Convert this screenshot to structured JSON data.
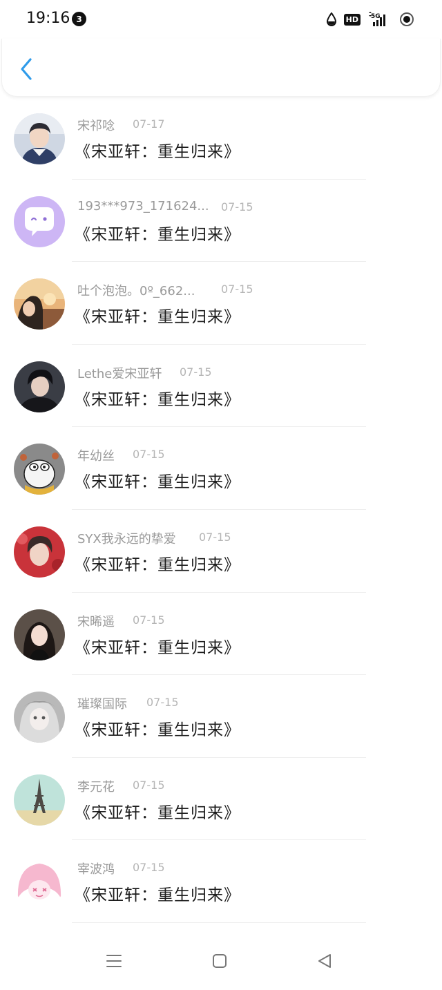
{
  "status_bar": {
    "time": "19:16",
    "notification_count": "3",
    "icons": [
      "water-drop-icon",
      "hd-icon",
      "5g-signal-icon",
      "record-icon"
    ],
    "hd_label": "HD",
    "network_label": "5G"
  },
  "header": {
    "back_icon": "chevron-left-icon",
    "accent": "#2f9bea"
  },
  "items": [
    {
      "name": "宋祁唸",
      "date": "07-17",
      "title": "《宋亚轩：重生归来》",
      "avatar": "boy-avatar"
    },
    {
      "name": "193***973_171624...",
      "date": "07-15",
      "title": "《宋亚轩：重生归来》",
      "avatar": "chat-bubble-avatar"
    },
    {
      "name": "吐个泡泡。0º_662...",
      "date": "07-15",
      "title": "《宋亚轩：重生归来》",
      "avatar": "girl-sunset-avatar"
    },
    {
      "name": "Lethe爱宋亚轩",
      "date": "07-15",
      "title": "《宋亚轩：重生归来》",
      "avatar": "boy-dark-avatar"
    },
    {
      "name": "年幼丝",
      "date": "07-15",
      "title": "《宋亚轩：重生归来》",
      "avatar": "cartoon-duck-avatar"
    },
    {
      "name": "SYX我永远的挚爱",
      "date": "07-15",
      "title": "《宋亚轩：重生归来》",
      "avatar": "boy-red-avatar"
    },
    {
      "name": "宋晞遥",
      "date": "07-15",
      "title": "《宋亚轩：重生归来》",
      "avatar": "girl-portrait-avatar"
    },
    {
      "name": "璀璨国际",
      "date": "07-15",
      "title": "《宋亚轩：重生归来》",
      "avatar": "anime-gray-avatar"
    },
    {
      "name": "李元花",
      "date": "07-15",
      "title": "《宋亚轩：重生归来》",
      "avatar": "eiffel-tower-avatar"
    },
    {
      "name": "宰波鸿",
      "date": "07-15",
      "title": "《宋亚轩：重生归来》",
      "avatar": "pink-anime-avatar"
    }
  ],
  "nav_bar": {
    "icons": [
      "menu-icon",
      "home-square-icon",
      "back-triangle-icon"
    ]
  }
}
